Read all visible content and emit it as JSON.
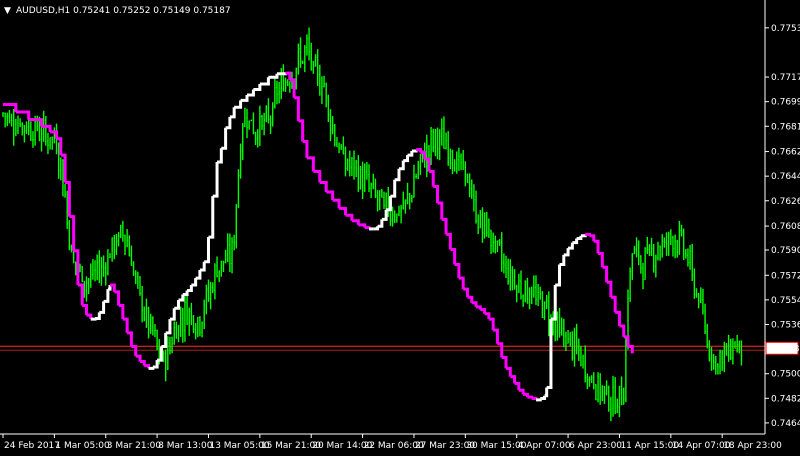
{
  "header": {
    "collapse_glyph": "▼",
    "title": "AUDUSD,H1  0.75241 0.75252 0.75149 0.75187"
  },
  "colors": {
    "background": "#000000",
    "candles": "#00ff00",
    "ma_up": "#ffffff",
    "ma_down": "#ff00ff",
    "price_line": "#ff2a2a",
    "axis": "#ffffff",
    "price_tag_bg": "#ffffff",
    "price_tag_border": "#ff0000"
  },
  "chart_data": {
    "type": "line",
    "symbol": "AUDUSD",
    "timeframe": "H1",
    "ohlc": {
      "open": 0.75241,
      "high": 0.75252,
      "low": 0.75149,
      "close": 0.75187
    },
    "current_price_label": "0.75187",
    "current_price": 0.75187,
    "ylim": [
      0.7456,
      0.7772
    ],
    "y_tick_labels": [
      "0.77531",
      "0.77171",
      "0.76991",
      "0.76811",
      "0.76626",
      "0.76446",
      "0.76266",
      "0.76081",
      "0.75906",
      "0.75721",
      "0.75541",
      "0.75361",
      "0.75001",
      "0.74821",
      "0.74641"
    ],
    "y_tick_values": [
      0.77531,
      0.77171,
      0.76991,
      0.76811,
      0.76626,
      0.76446,
      0.76266,
      0.76081,
      0.75906,
      0.75721,
      0.75541,
      0.75361,
      0.75001,
      0.74821,
      0.74641
    ],
    "x_tick_labels": [
      "24 Feb 2017",
      "1 Mar 05:00",
      "3 Mar 21:00",
      "8 Mar 13:00",
      "13 Mar 05:00",
      "15 Mar 21:00",
      "20 Mar 14:00",
      "22 Mar 06:00",
      "27 Mar 23:00",
      "30 Mar 15:00",
      "4 Apr 07:00",
      "6 Apr 23:00",
      "11 Apr 15:00",
      "14 Apr 07:00",
      "18 Apr 23:00"
    ],
    "x_tick_positions": [
      0,
      24,
      48,
      72,
      96,
      120,
      144,
      168,
      192,
      216,
      240,
      264,
      288,
      312,
      336
    ],
    "x_range": [
      0,
      356
    ],
    "price_series": [
      [
        0,
        0.769
      ],
      [
        4,
        0.7686
      ],
      [
        8,
        0.7683
      ],
      [
        12,
        0.768
      ],
      [
        16,
        0.7679
      ],
      [
        20,
        0.7674
      ],
      [
        22,
        0.7672
      ],
      [
        24,
        0.7672
      ],
      [
        26,
        0.766
      ],
      [
        28,
        0.764
      ],
      [
        30,
        0.7615
      ],
      [
        32,
        0.7588
      ],
      [
        35,
        0.7576
      ],
      [
        38,
        0.7568
      ],
      [
        41,
        0.757
      ],
      [
        44,
        0.7576
      ],
      [
        47,
        0.7578
      ],
      [
        50,
        0.759
      ],
      [
        53,
        0.7596
      ],
      [
        56,
        0.7604
      ],
      [
        58,
        0.7598
      ],
      [
        60,
        0.7583
      ],
      [
        63,
        0.756
      ],
      [
        66,
        0.7545
      ],
      [
        68,
        0.7535
      ],
      [
        70,
        0.753
      ],
      [
        72,
        0.7518
      ],
      [
        74,
        0.7508
      ],
      [
        76,
        0.7512
      ],
      [
        78,
        0.7521
      ],
      [
        80,
        0.7531
      ],
      [
        83,
        0.754
      ],
      [
        86,
        0.7546
      ],
      [
        89,
        0.7543
      ],
      [
        91,
        0.7536
      ],
      [
        94,
        0.755
      ],
      [
        97,
        0.7562
      ],
      [
        100,
        0.7578
      ],
      [
        103,
        0.7582
      ],
      [
        106,
        0.7585
      ],
      [
        108,
        0.7598
      ],
      [
        110,
        0.7651
      ],
      [
        112,
        0.7681
      ],
      [
        114,
        0.7691
      ],
      [
        116,
        0.7684
      ],
      [
        118,
        0.7676
      ],
      [
        120,
        0.7683
      ],
      [
        123,
        0.7683
      ],
      [
        125,
        0.7688
      ],
      [
        128,
        0.7705
      ],
      [
        131,
        0.7712
      ],
      [
        134,
        0.7719
      ],
      [
        137,
        0.7726
      ],
      [
        140,
        0.7732
      ],
      [
        142,
        0.7738
      ],
      [
        144,
        0.7726
      ],
      [
        146,
        0.7719
      ],
      [
        148,
        0.7714
      ],
      [
        150,
        0.7712
      ],
      [
        152,
        0.7692
      ],
      [
        155,
        0.7675
      ],
      [
        158,
        0.766
      ],
      [
        161,
        0.7653
      ],
      [
        164,
        0.765
      ],
      [
        167,
        0.7643
      ],
      [
        170,
        0.764
      ],
      [
        173,
        0.7633
      ],
      [
        176,
        0.7626
      ],
      [
        179,
        0.7622
      ],
      [
        182,
        0.762
      ],
      [
        185,
        0.7618
      ],
      [
        188,
        0.7622
      ],
      [
        191,
        0.7635
      ],
      [
        194,
        0.765
      ],
      [
        197,
        0.766
      ],
      [
        200,
        0.7668
      ],
      [
        203,
        0.7672
      ],
      [
        206,
        0.7669
      ],
      [
        209,
        0.7663
      ],
      [
        212,
        0.7655
      ],
      [
        215,
        0.7648
      ],
      [
        218,
        0.7638
      ],
      [
        220,
        0.762
      ],
      [
        222,
        0.7612
      ],
      [
        225,
        0.7608
      ],
      [
        228,
        0.76
      ],
      [
        231,
        0.759
      ],
      [
        234,
        0.758
      ],
      [
        237,
        0.7572
      ],
      [
        240,
        0.7565
      ],
      [
        243,
        0.7563
      ],
      [
        246,
        0.756
      ],
      [
        249,
        0.7555
      ],
      [
        252,
        0.7552
      ],
      [
        255,
        0.7545
      ],
      [
        258,
        0.7535
      ],
      [
        261,
        0.7528
      ],
      [
        264,
        0.7525
      ],
      [
        267,
        0.7519
      ],
      [
        270,
        0.751
      ],
      [
        273,
        0.75
      ],
      [
        276,
        0.7494
      ],
      [
        279,
        0.7488
      ],
      [
        282,
        0.7486
      ],
      [
        285,
        0.748
      ],
      [
        288,
        0.748
      ],
      [
        290,
        0.7492
      ],
      [
        292,
        0.7556
      ],
      [
        294,
        0.759
      ],
      [
        296,
        0.7587
      ],
      [
        298,
        0.758
      ],
      [
        300,
        0.7583
      ],
      [
        303,
        0.7589
      ],
      [
        306,
        0.7592
      ],
      [
        309,
        0.7595
      ],
      [
        312,
        0.7601
      ],
      [
        315,
        0.7598
      ],
      [
        318,
        0.7593
      ],
      [
        320,
        0.7585
      ],
      [
        322,
        0.757
      ],
      [
        325,
        0.7555
      ],
      [
        327,
        0.754
      ],
      [
        329,
        0.7525
      ],
      [
        331,
        0.7515
      ],
      [
        333,
        0.751
      ],
      [
        336,
        0.751
      ],
      [
        339,
        0.7518
      ],
      [
        341,
        0.7522
      ],
      [
        343,
        0.7522
      ],
      [
        345,
        0.7521
      ]
    ],
    "ma_series": [
      [
        0,
        0.7697
      ],
      [
        6,
        0.76915
      ],
      [
        12,
        0.7686
      ],
      [
        18,
        0.7681
      ],
      [
        22,
        0.7677
      ],
      [
        25,
        0.7672
      ],
      [
        27,
        0.766
      ],
      [
        29,
        0.764
      ],
      [
        31,
        0.7615
      ],
      [
        33,
        0.759
      ],
      [
        35,
        0.7565
      ],
      [
        37,
        0.755
      ],
      [
        39,
        0.7543
      ],
      [
        41,
        0.754
      ],
      [
        43,
        0.75405
      ],
      [
        45,
        0.7545
      ],
      [
        47,
        0.7553
      ],
      [
        49,
        0.7562
      ],
      [
        50,
        0.7565
      ],
      [
        52,
        0.756
      ],
      [
        54,
        0.755
      ],
      [
        56,
        0.754
      ],
      [
        58,
        0.753
      ],
      [
        60,
        0.752
      ],
      [
        62,
        0.7513
      ],
      [
        64,
        0.7509
      ],
      [
        66,
        0.7506
      ],
      [
        68,
        0.7504
      ],
      [
        70,
        0.7505
      ],
      [
        72,
        0.751
      ],
      [
        74,
        0.752
      ],
      [
        76,
        0.753
      ],
      [
        78,
        0.754
      ],
      [
        80,
        0.7548
      ],
      [
        82,
        0.7554
      ],
      [
        84,
        0.7558
      ],
      [
        86,
        0.7561
      ],
      [
        88,
        0.7565
      ],
      [
        90,
        0.757
      ],
      [
        92,
        0.7576
      ],
      [
        94,
        0.7582
      ],
      [
        96,
        0.76
      ],
      [
        98,
        0.763
      ],
      [
        100,
        0.7655
      ],
      [
        102,
        0.7665
      ],
      [
        104,
        0.768
      ],
      [
        106,
        0.7688
      ],
      [
        108,
        0.7695
      ],
      [
        111,
        0.77
      ],
      [
        114,
        0.7704
      ],
      [
        117,
        0.7708
      ],
      [
        120,
        0.7712
      ],
      [
        124,
        0.7717
      ],
      [
        128,
        0.77195
      ],
      [
        132,
        0.772
      ],
      [
        134,
        0.7715
      ],
      [
        136,
        0.7702
      ],
      [
        138,
        0.7685
      ],
      [
        140,
        0.767
      ],
      [
        142,
        0.7658
      ],
      [
        145,
        0.7648
      ],
      [
        148,
        0.764
      ],
      [
        151,
        0.7633
      ],
      [
        154,
        0.7627
      ],
      [
        157,
        0.7621
      ],
      [
        160,
        0.7616
      ],
      [
        163,
        0.7612
      ],
      [
        166,
        0.7609
      ],
      [
        169,
        0.7607
      ],
      [
        171,
        0.7606
      ],
      [
        173,
        0.7606
      ],
      [
        175,
        0.7608
      ],
      [
        177,
        0.7613
      ],
      [
        179,
        0.762
      ],
      [
        181,
        0.763
      ],
      [
        183,
        0.7642
      ],
      [
        185,
        0.765
      ],
      [
        187,
        0.7656
      ],
      [
        189,
        0.766
      ],
      [
        191,
        0.7663
      ],
      [
        193,
        0.7664
      ],
      [
        195,
        0.7662
      ],
      [
        197,
        0.7657
      ],
      [
        199,
        0.7648
      ],
      [
        201,
        0.7637
      ],
      [
        203,
        0.7625
      ],
      [
        205,
        0.7613
      ],
      [
        207,
        0.7602
      ],
      [
        209,
        0.7591
      ],
      [
        211,
        0.758
      ],
      [
        213,
        0.757
      ],
      [
        215,
        0.7562
      ],
      [
        217,
        0.7556
      ],
      [
        219,
        0.7552
      ],
      [
        221,
        0.7549
      ],
      [
        223,
        0.7547
      ],
      [
        225,
        0.7544
      ],
      [
        227,
        0.754
      ],
      [
        229,
        0.7532
      ],
      [
        231,
        0.7522
      ],
      [
        233,
        0.7512
      ],
      [
        235,
        0.7504
      ],
      [
        237,
        0.7498
      ],
      [
        239,
        0.7493
      ],
      [
        241,
        0.7488
      ],
      [
        243,
        0.7485
      ],
      [
        245,
        0.7483
      ],
      [
        247,
        0.7482
      ],
      [
        249,
        0.7481
      ],
      [
        251,
        0.7482
      ],
      [
        253,
        0.7484
      ],
      [
        254,
        0.749
      ],
      [
        256,
        0.754
      ],
      [
        258,
        0.7565
      ],
      [
        260,
        0.758
      ],
      [
        262,
        0.7587
      ],
      [
        264,
        0.7592
      ],
      [
        266,
        0.7596
      ],
      [
        268,
        0.7599
      ],
      [
        270,
        0.7601
      ],
      [
        272,
        0.7602
      ],
      [
        274,
        0.7601
      ],
      [
        276,
        0.7597
      ],
      [
        278,
        0.7588
      ],
      [
        280,
        0.7578
      ],
      [
        282,
        0.7567
      ],
      [
        284,
        0.7556
      ],
      [
        286,
        0.7545
      ],
      [
        288,
        0.7535
      ],
      [
        290,
        0.7527
      ],
      [
        292,
        0.752
      ],
      [
        294,
        0.7515
      ]
    ]
  }
}
